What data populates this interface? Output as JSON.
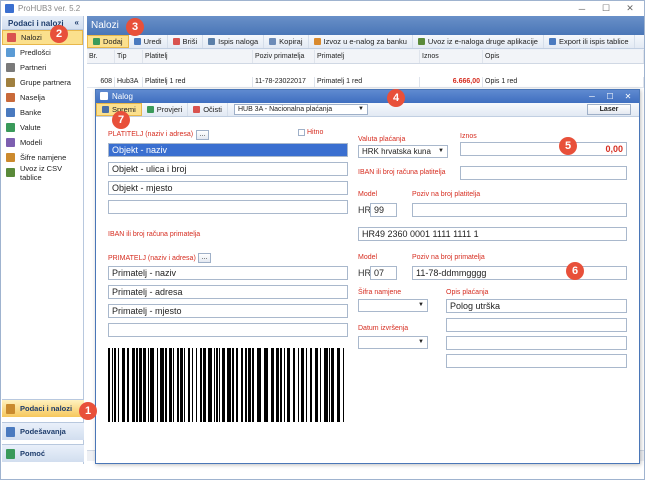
{
  "app": {
    "title": "ProHUB3 ver. 5.2"
  },
  "leftnav": {
    "header": "Podaci i nalozi",
    "collapse": "«",
    "items": [
      {
        "label": "Nalozi",
        "icon": "orders-icon",
        "color": "#d9534f"
      },
      {
        "label": "Predlošci",
        "icon": "templates-icon",
        "color": "#5b9bd5"
      },
      {
        "label": "Partneri",
        "icon": "partners-icon",
        "color": "#7a7a7a"
      },
      {
        "label": "Grupe partnera",
        "icon": "partner-groups-icon",
        "color": "#a08040"
      },
      {
        "label": "Naselja",
        "icon": "places-icon",
        "color": "#c96a3a"
      },
      {
        "label": "Banke",
        "icon": "banks-icon",
        "color": "#4a7abf"
      },
      {
        "label": "Valute",
        "icon": "currency-icon",
        "color": "#3a9a5a"
      },
      {
        "label": "Modeli",
        "icon": "models-icon",
        "color": "#7d5fb0"
      },
      {
        "label": "Šifre namjene",
        "icon": "purpose-codes-icon",
        "color": "#cc8a2e"
      },
      {
        "label": "Uvoz iz CSV tablice",
        "icon": "csv-import-icon",
        "color": "#5a8a3a"
      }
    ],
    "bottom": [
      {
        "label": "Podaci i nalozi",
        "icon": "data-orders-icon"
      },
      {
        "label": "Podešavanja",
        "icon": "settings-icon"
      },
      {
        "label": "Pomoć",
        "icon": "help-icon"
      }
    ]
  },
  "main": {
    "title": "Nalozi",
    "toolbar": [
      {
        "label": "Dodaj",
        "icon": "add-icon",
        "color": "#3a9a5a"
      },
      {
        "label": "Uredi",
        "icon": "edit-icon",
        "color": "#4a7abf"
      },
      {
        "label": "Briši",
        "icon": "delete-icon",
        "color": "#d9534f"
      },
      {
        "label": "Ispis naloga",
        "icon": "print-icon",
        "color": "#5b7fa8"
      },
      {
        "label": "Kopiraj",
        "icon": "copy-icon",
        "color": "#6d8cb8"
      },
      {
        "label": "Izvoz u e-nalog za banku",
        "icon": "export-icon",
        "color": "#d98a2e"
      },
      {
        "label": "Uvoz iz e-naloga druge aplikacije",
        "icon": "import-icon",
        "color": "#5a8a3a"
      },
      {
        "label": "Export ili ispis tablice",
        "icon": "table-export-icon",
        "color": "#4a7abf"
      }
    ],
    "grid": {
      "columns": [
        "Br.",
        "Tip",
        "Platitelj",
        "Poziv primatelja",
        "Primatelj",
        "Iznos",
        "Opis"
      ],
      "row": [
        "608",
        "Hub3A",
        "Platitelj 1 red",
        "11-78-23022017",
        "Primatelj 1 red",
        "6.666,00",
        "Opis 1 red"
      ]
    }
  },
  "dialog": {
    "title": "Nalog",
    "toolbar": {
      "save": "Spremi",
      "check": "Provjeri",
      "clear": "Očisti",
      "form_type": "HUB 3A - Nacionalna plaćanja",
      "laser": "Laser"
    },
    "payer": {
      "label": "PLATITELJ (naziv i adresa)",
      "dots": "...",
      "urgent_label": "Hitno",
      "name": "Objekt - naziv",
      "street": "Objekt - ulica i broj",
      "city": "Objekt - mjesto",
      "extra": ""
    },
    "iban_recipient_label": "IBAN ili broj računa primatelja",
    "recipient": {
      "label": "PRIMATELJ (naziv i adresa)",
      "dots": "...",
      "name": "Primatelj - naziv",
      "address": "Primatelj - adresa",
      "city": "Primatelj - mjesto",
      "extra": ""
    },
    "currency": {
      "label": "Valuta plaćanja",
      "value": "HRK hrvatska kuna"
    },
    "amount": {
      "label": "Iznos",
      "value": "0,00"
    },
    "iban_payer_label": "IBAN ili broj računa platitelja",
    "iban_payer_value": "",
    "payer_model": {
      "label": "Model",
      "prefix": "HR",
      "value": "99"
    },
    "payer_ref": {
      "label": "Poziv na broj platitelja",
      "value": ""
    },
    "iban_recipient_value": "HR49 2360 0001 1111 1111 1",
    "recipient_model": {
      "label": "Model",
      "prefix": "HR",
      "value": "07"
    },
    "recipient_ref": {
      "label": "Poziv na broj primatelja",
      "value": "11-78-ddmmgggg"
    },
    "purpose_code": {
      "label": "Šifra namjene",
      "value": ""
    },
    "description": {
      "label": "Opis plaćanja",
      "value": "Polog utrška"
    },
    "exec_date": {
      "label": "Datum izvršenja",
      "value": ""
    }
  },
  "badges": [
    "1",
    "2",
    "3",
    "4",
    "5",
    "6",
    "7"
  ]
}
